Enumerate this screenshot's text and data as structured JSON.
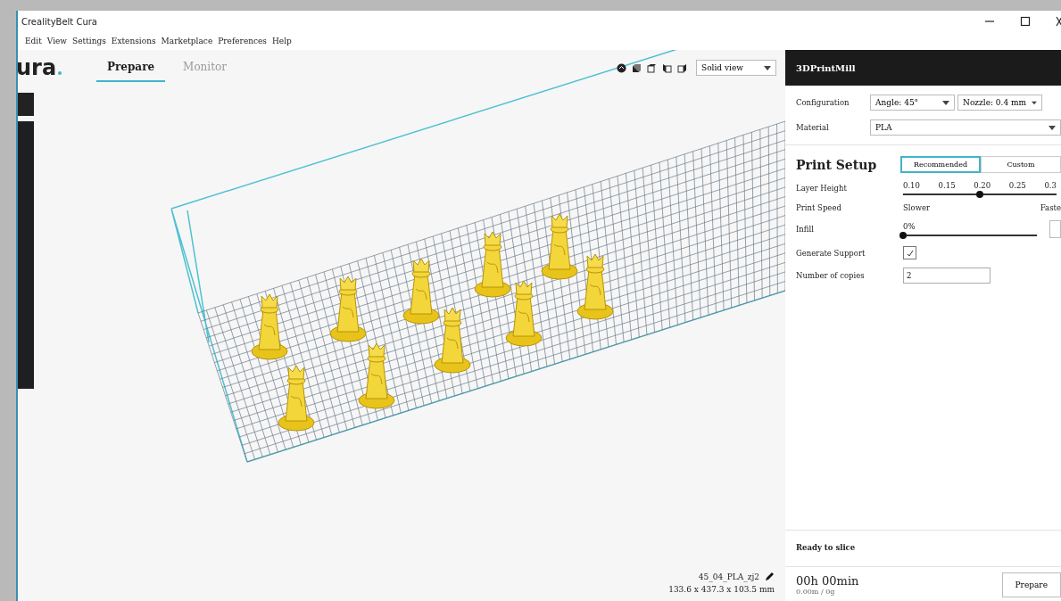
{
  "window": {
    "title": "CrealityBelt Cura"
  },
  "menu": [
    "Edit",
    "View",
    "Settings",
    "Extensions",
    "Marketplace",
    "Preferences",
    "Help"
  ],
  "logo": {
    "text": "ura"
  },
  "stages": [
    {
      "label": "Prepare",
      "selected": true
    },
    {
      "label": "Monitor",
      "selected": false
    }
  ],
  "view_mode": {
    "value": "Solid view"
  },
  "printer": {
    "name": "3DPrintMill",
    "configuration_label": "Configuration",
    "configuration": [
      "Angle: 45°",
      "Nozzle: 0.4 mm"
    ],
    "material_label": "Material",
    "material": "PLA"
  },
  "print_setup": {
    "title": "Print Setup",
    "tabs": [
      {
        "label": "Recommended",
        "selected": true
      },
      {
        "label": "Custom",
        "selected": false
      }
    ],
    "layer_height": {
      "label": "Layer Height",
      "ticks": [
        "0.10",
        "0.15",
        "0.20",
        "0.25",
        "0.3"
      ],
      "level": 0.5
    },
    "print_speed": {
      "label": "Print Speed",
      "min": "Slower",
      "max": "Faste"
    },
    "infill": {
      "label": "Infill",
      "reading": "0%",
      "level": 0
    },
    "support": {
      "label": "Generate Support",
      "checked": true
    },
    "copies": {
      "label": "Number of copies",
      "value": "2"
    }
  },
  "model": {
    "name": "45_04_PLA_zj2",
    "dimensions": "133.6 x 437.3 x 103.5 mm"
  },
  "slice": {
    "status": "Ready to slice",
    "time": "00h 00min",
    "usage": "0.00m / 0g",
    "button": "Prepare"
  }
}
